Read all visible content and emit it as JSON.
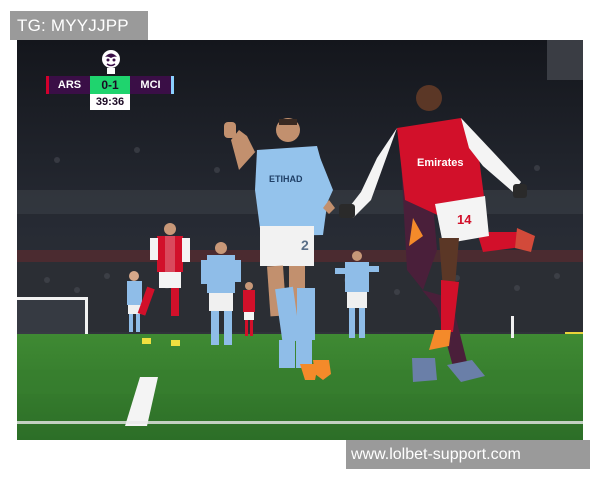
{
  "tag": {
    "text": "TG: MYYJJPP"
  },
  "watermark": {
    "text": "www.lolbet-support.com"
  },
  "scorebug": {
    "home": "ARS",
    "score": "0-1",
    "away": "MCI",
    "clock": "39:36"
  },
  "shirts": {
    "walker_number": "2",
    "nketiah_number": "14",
    "walker_sponsor": "ETIHAD",
    "nketiah_sponsor": "Emirates"
  },
  "colors": {
    "arsenal_red": "#d2102a",
    "city_sky_blue": "#8fbde8",
    "pitch_green": "#2f7a2c",
    "scorebug_purple": "#3a0e46",
    "scorebug_green": "#1fd46e"
  }
}
